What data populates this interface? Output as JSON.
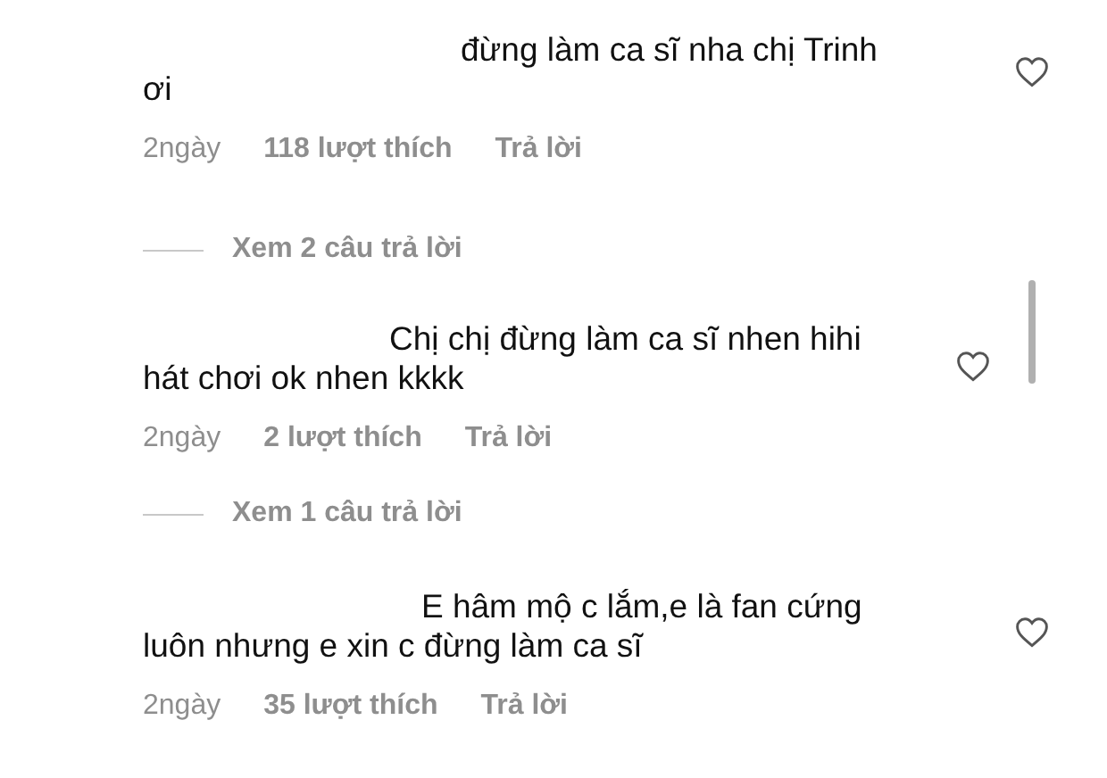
{
  "comments": [
    {
      "line_1": "đừng làm ca sĩ nha chị Trinh",
      "line_2": "ơi",
      "time": "2ngày",
      "likes": "118 lượt thích",
      "reply": "Trả lời",
      "view_replies": "Xem 2 câu trả lời",
      "liked": false
    },
    {
      "line_1": "Chị chị đừng làm ca sĩ nhen hihi",
      "line_2": "hát chơi ok nhen kkkk",
      "time": "2ngày",
      "likes": "2 lượt thích",
      "reply": "Trả lời",
      "view_replies": "Xem 1 câu trả lời",
      "liked": false
    },
    {
      "line_1": "E hâm mộ c lắm,e là fan cứng",
      "line_2": "luôn nhưng e xin c đừng làm ca sĩ",
      "time": "2ngày",
      "likes": "35 lượt thích",
      "reply": "Trả lời",
      "liked": false
    }
  ]
}
